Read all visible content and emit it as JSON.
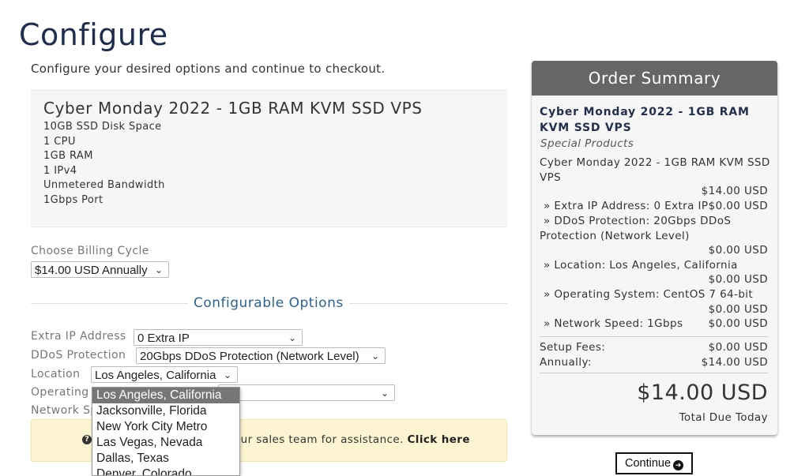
{
  "page": {
    "title": "Configure",
    "subtitle": "Configure your desired options and continue to checkout."
  },
  "product": {
    "name": "Cyber Monday 2022 - 1GB RAM KVM SSD VPS",
    "features": [
      "10GB SSD Disk Space",
      "1 CPU",
      "1GB RAM",
      "1 IPv4",
      "Unmetered Bandwidth",
      "1Gbps Port"
    ]
  },
  "billing": {
    "label": "Choose Billing Cycle",
    "selected": "$14.00 USD Annually"
  },
  "options": {
    "section_title": "Configurable Options",
    "extra_ip": {
      "label": "Extra IP Address",
      "value": "0 Extra IP"
    },
    "ddos": {
      "label": "DDoS Protection",
      "value": "20Gbps DDoS Protection (Network Level)"
    },
    "location": {
      "label": "Location",
      "value": "Los Angeles, California"
    },
    "os": {
      "label": "Operating"
    },
    "network": {
      "label": "Network Sp"
    }
  },
  "location_dropdown": {
    "options": [
      "Los Angeles, California",
      "Jacksonville, Florida",
      "New York City Metro",
      "Las Vegas, Nevada",
      "Dallas, Texas",
      "Denver, Colorado"
    ],
    "highlighted_index": 0
  },
  "info_bar": {
    "icon": "question-circle-icon",
    "text": "our sales team for assistance.",
    "link": "Click here"
  },
  "summary": {
    "header": "Order Summary",
    "product_line1": "Cyber Monday 2022 - 1GB RAM",
    "product_line2": "KVM SSD VPS",
    "group": "Special Products",
    "item_line1": "Cyber Monday 2022 - 1GB RAM KVM SSD",
    "item_line2": "VPS",
    "item_price": "$14.00 USD",
    "extra_ip": "» Extra IP Address: 0 Extra IP",
    "extra_ip_price": "$0.00 USD",
    "ddos_line1": "» DDoS Protection: 20Gbps DDoS",
    "ddos_line2": "Protection (Network Level)",
    "ddos_price": "$0.00 USD",
    "location": "» Location: Los Angeles, California",
    "location_price": "$0.00 USD",
    "os": "» Operating System: CentOS 7 64-bit",
    "os_price": "$0.00 USD",
    "network": "» Network Speed: 1Gbps",
    "network_price": "$0.00 USD",
    "setup_label": "Setup Fees:",
    "setup_value": "$0.00 USD",
    "annually_label": "Annually:",
    "annually_value": "$14.00 USD",
    "total_amount": "$14.00 USD",
    "total_label": "Total Due Today"
  },
  "continue_button": {
    "label": "Continue",
    "icon": "arrow-circle-right-icon"
  }
}
